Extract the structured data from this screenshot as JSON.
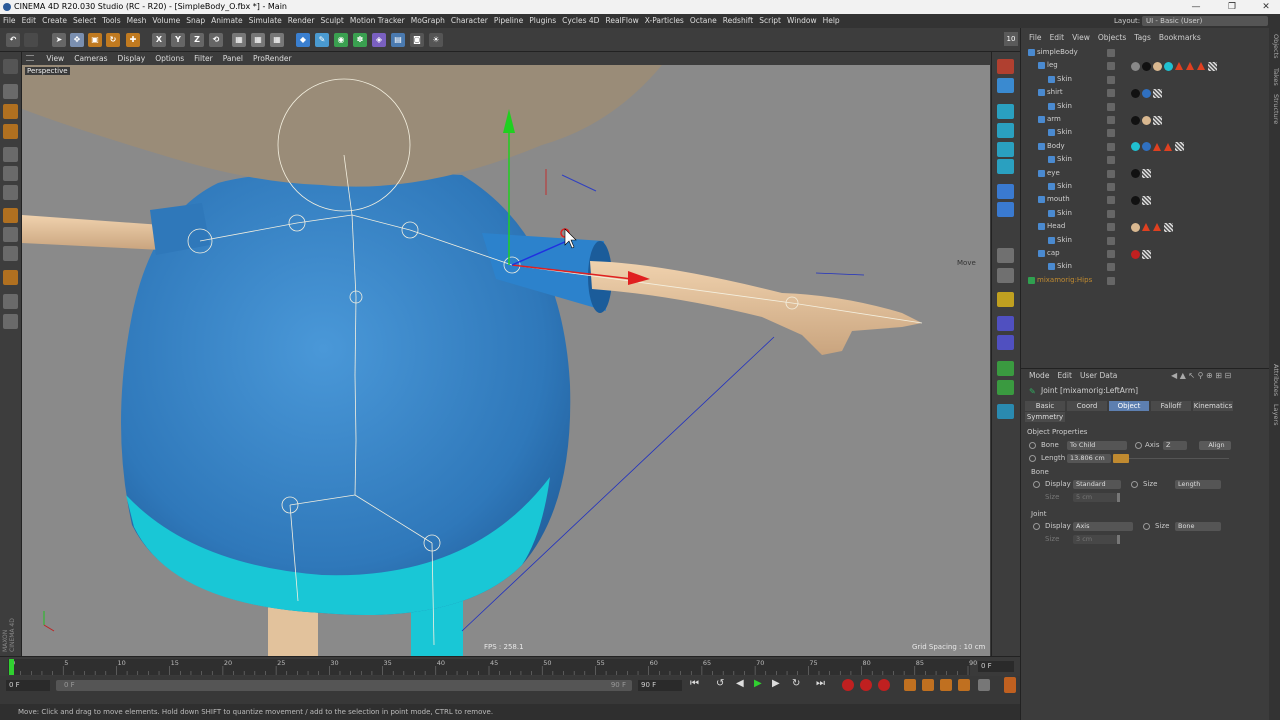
{
  "window": {
    "title": "CINEMA 4D R20.030 Studio (RC - R20) - [SimpleBody_O.fbx *] - Main",
    "min_glyph": "—",
    "max_glyph": "❐",
    "close_glyph": "✕"
  },
  "menubar": [
    "File",
    "Edit",
    "Create",
    "Select",
    "Tools",
    "Mesh",
    "Volume",
    "Snap",
    "Animate",
    "Simulate",
    "Render",
    "Sculpt",
    "Motion Tracker",
    "MoGraph",
    "Character",
    "Pipeline",
    "Plugins",
    "Cycles 4D",
    "RealFlow",
    "X-Particles",
    "Octane",
    "Redshift",
    "Script",
    "Window",
    "Help"
  ],
  "layout": {
    "label": "Layout:",
    "value": "UI - Basic (User)"
  },
  "toolbar": {
    "axis_x": "X",
    "axis_y": "Y",
    "axis_z": "Z"
  },
  "viewport": {
    "menu": [
      "View",
      "Cameras",
      "Display",
      "Options",
      "Filter",
      "Panel",
      "ProRender"
    ],
    "label": "Perspective",
    "fps": "FPS : 258.1",
    "grid_spacing": "Grid Spacing : 10 cm",
    "tool_hint": "Move",
    "colors": {
      "body": "#3a86c8",
      "shirt_band": "#19c7d6",
      "skin": "#e7c7a0",
      "head": "#9a8c78",
      "bg": "#8a8a8a"
    }
  },
  "objects_panel": {
    "menu": [
      "File",
      "Edit",
      "View",
      "Objects",
      "Tags",
      "Bookmarks"
    ],
    "root": "simpleBody",
    "items": [
      {
        "name": "leg",
        "child": "Skin",
        "tags": [
          "sphere-gray",
          "sphere-black",
          "sphere-beige",
          "sphere-teal",
          "tri",
          "tri",
          "tri",
          "checker"
        ]
      },
      {
        "name": "shirt",
        "child": "Skin",
        "tags": [
          "sphere-black",
          "sphere-blue",
          "checker"
        ]
      },
      {
        "name": "arm",
        "child": "Skin",
        "tags": [
          "sphere-black",
          "sphere-beige",
          "checker"
        ]
      },
      {
        "name": "Body",
        "child": "Skin",
        "tags": [
          "sphere-teal",
          "sphere-blue",
          "tri",
          "tri",
          "checker"
        ]
      },
      {
        "name": "eye",
        "child": "Skin",
        "tags": [
          "sphere-black",
          "checker"
        ]
      },
      {
        "name": "mouth",
        "child": "Skin",
        "tags": [
          "sphere-black",
          "checker"
        ]
      },
      {
        "name": "Head",
        "child": "Skin",
        "tags": [
          "sphere-beige",
          "tri",
          "tri",
          "checker"
        ]
      },
      {
        "name": "cap",
        "child": "Skin",
        "tags": [
          "sphere-red",
          "checker"
        ]
      }
    ],
    "rig": "mixamorig:Hips"
  },
  "attributes": {
    "menu": [
      "Mode",
      "Edit",
      "User Data"
    ],
    "title": "Joint [mixamorig:LeftArm]",
    "tabs": [
      "Basic",
      "Coord",
      "Object",
      "Falloff",
      "Kinematics",
      "Symmetry"
    ],
    "selected_tab": "Object",
    "section": "Object Properties",
    "bone_label": "Bone",
    "bone_value": "To Child",
    "axis_label": "Axis",
    "axis_value": "Z",
    "align_label": "Align",
    "length_label": "Length",
    "length_value": "13.806 cm",
    "bone_group": "Bone",
    "display_label": "Display",
    "bone_display_value": "Standard",
    "size_label": "Size",
    "bone_size_value": "Length",
    "size2_label": "Size",
    "bone_size_num": "5 cm",
    "joint_group": "Joint",
    "joint_display_value": "Axis",
    "joint_size_value": "Bone",
    "joint_size_num": "3 cm"
  },
  "side_tabs": [
    "Objects",
    "Takes",
    "Structure",
    "Attributes",
    "Layers"
  ],
  "timeline": {
    "ticks": [
      "0",
      "5",
      "10",
      "15",
      "20",
      "25",
      "30",
      "35",
      "40",
      "45",
      "50",
      "55",
      "60",
      "65",
      "70",
      "75",
      "80",
      "85",
      "90"
    ],
    "current_frame_field": "0 F",
    "start_field": "0 F",
    "slider_left": "0 F",
    "slider_right": "90 F",
    "end_field": "90 F"
  },
  "status": "Move: Click and drag to move elements. Hold down SHIFT to quantize movement / add to the selection in point mode, CTRL to remove."
}
